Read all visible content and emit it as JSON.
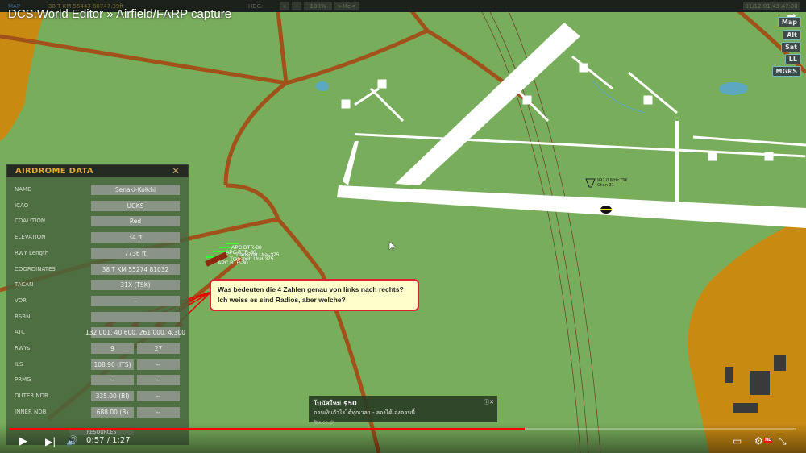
{
  "topbar": {
    "mode": "MAP",
    "coords": "38 T KM 55443 80747.39ft",
    "hdg_label": "HDG:",
    "zoom": "100%",
    "me_button": ">Me<",
    "datetime": "01/12:01:43 A7:00"
  },
  "title": "DCS:World Editor » Airfield/FARP capture",
  "map_buttons": [
    "Map",
    "Alt",
    "Sat",
    "LL",
    "MGRS"
  ],
  "panel": {
    "title": "AIRDROME DATA",
    "rows": [
      {
        "label": "NAME",
        "value": "Senaki-Kolkhi"
      },
      {
        "label": "ICAO",
        "value": "UGKS"
      },
      {
        "label": "COALITION",
        "value": "Red"
      },
      {
        "label": "ELEVATION",
        "value": "34 ft"
      },
      {
        "label": "RWY Length",
        "value": "7736 ft"
      },
      {
        "label": "COORDINATES",
        "value": "38 T KM 55274 81032"
      },
      {
        "label": "TACAN",
        "value": "31X (TSK)"
      },
      {
        "label": "VOR",
        "value": "--"
      },
      {
        "label": "RSBN",
        "value": ""
      },
      {
        "label": "ATC",
        "value": "132.001, 40.600, 261.000, 4.300"
      },
      {
        "label": "RWYs",
        "value": "9",
        "value2": "27"
      },
      {
        "label": "ILS",
        "value": "108.90 (ITS)",
        "value2": "--"
      },
      {
        "label": "PRMG",
        "value": "--",
        "value2": "--"
      },
      {
        "label": "OUTER NDB",
        "value": "335.00 (BI)",
        "value2": "--"
      },
      {
        "label": "INNER NDB",
        "value": "688.00 (B)",
        "value2": "--"
      }
    ]
  },
  "units": [
    "APC BTR-80",
    "APC BTR-80",
    "Transport Ural-375",
    "Transport Ural-375",
    "APC BTR-80"
  ],
  "tacan_label": {
    "freq": "992.0 MHz TSK",
    "chan": "Chan 31"
  },
  "callout": {
    "line1": "Was bedeuten die 4 Zahlen genau von links nach rechts?",
    "line2": "Ich weiss es sind Radios, aber welche?"
  },
  "ad": {
    "title": "โบนัสใหม่ $50",
    "text": "ถอนเงินกำไรได้ทุกเวลา - ลองได้เองตอนนี้",
    "url": "fbs.co.th"
  },
  "player": {
    "time": "0:57 / 1:27",
    "progress": 0.655,
    "resources": "RESOURCES",
    "hd": "HD"
  },
  "colors": {
    "map": "#78ad5c",
    "road": "#a0521a",
    "accent": "#e0a840",
    "progress": "#ff0000"
  }
}
